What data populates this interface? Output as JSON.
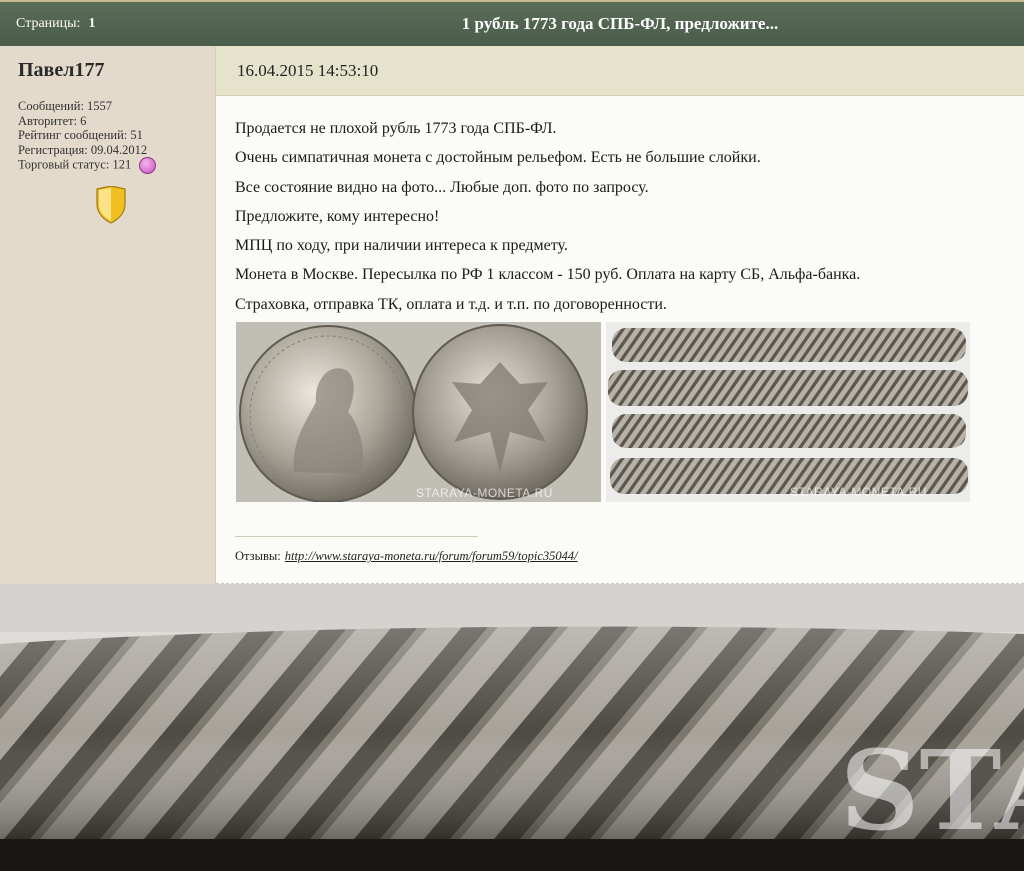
{
  "header": {
    "pages_label": "Страницы:",
    "page_number": "1",
    "topic_title": "1 рубль 1773 года СПБ-ФЛ, предложите..."
  },
  "author": {
    "name": "Павел177",
    "stats": [
      "Сообщений: 1557",
      "Авторитет: 6",
      "Рейтинг сообщений: 51",
      "Регистрация: 09.04.2012"
    ],
    "trade_status": "Торговый статус: 121"
  },
  "post": {
    "date": "16.04.2015 14:53:10",
    "lines": [
      "Продается не плохой рубль 1773 года СПБ-ФЛ.",
      "Очень симпатичная монета с достойным рельефом. Есть не большие слойки.",
      "Все состояние видно на фото... Любые доп. фото по запросу.",
      "Предложите, кому интересно!",
      "МПЦ по ходу, при наличии интереса к предмету.",
      "Монета в Москве. Пересылка по РФ 1 классом - 150 руб. Оплата на карту СБ, Альфа-банка.",
      "Страховка, отправка ТК, оплата и т.д. и т.п. по договоренности."
    ],
    "watermark": "STARAYA-MONETA.RU",
    "big_watermark": "STA",
    "reviews_label": "Отзывы:",
    "reviews_link": "http://www.staraya-moneta.ru/forum/forum59/topic35044/"
  },
  "colors": {
    "topbar": "#4f614f",
    "left_column": "#e3dacb",
    "date_bar": "#e6e3cc",
    "trade_dot": "#d66cd0",
    "shield": "#f0c020"
  }
}
